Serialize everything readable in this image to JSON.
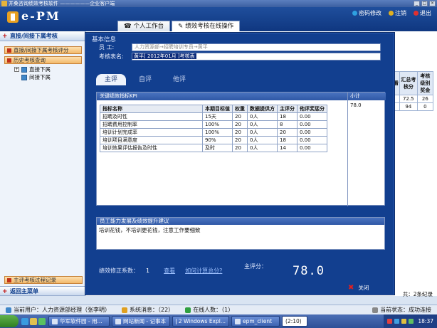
{
  "window": {
    "title": "并桑咨询绩效考核软件 ——————企业客户端"
  },
  "header": {
    "logo": "e-PM",
    "links": [
      {
        "label": "密码修改",
        "color": "#2fa0e0"
      },
      {
        "label": "注销",
        "color": "#e0b020"
      },
      {
        "label": "退出",
        "color": "#e03030"
      }
    ],
    "tabs": [
      {
        "label": "个人工作台"
      },
      {
        "label": "绩效考核在线操作"
      }
    ]
  },
  "leftnav": {
    "section": "直接/间接下属考核",
    "buttons": [
      "直接/间接下属考核评分",
      "历史考核查询"
    ],
    "tree": [
      "直接下属",
      "间接下属"
    ],
    "bottom_buttons": [
      "主评考核过程记录"
    ],
    "back_label": "返回主菜单"
  },
  "bgtable": {
    "headers": [
      "汇总考核分",
      "考核级别奖金"
    ],
    "partial_header": "看",
    "rows": [
      [
        "72.5",
        "26"
      ],
      [
        "94",
        "0"
      ]
    ]
  },
  "pager": {
    "text": "共：2条纪录"
  },
  "modal": {
    "section_basic": "基本信息",
    "employee_label": "员    工:",
    "employee_value": "人力资源部→招聘培训专员→黄平",
    "name_label": "考核表名:",
    "name_value": "黄平[ 2012年01月 ]考核表",
    "subtabs": [
      "主评",
      "自评",
      "他评"
    ],
    "kpi": {
      "title": "关键绩效指标KPI",
      "subtotal_label": "小计",
      "subtotal_value": "78.0",
      "headers": [
        "指标名称",
        "本期目标值",
        "权重",
        "数据提供方",
        "主评分",
        "他评奖惩分"
      ],
      "rows": [
        [
          "招聘及时性",
          "15天",
          "20",
          "0人",
          "18",
          "0.00"
        ],
        [
          "招聘费用控制率",
          "100%",
          "20",
          "0人",
          "8",
          "0.00"
        ],
        [
          "培训计划完成率",
          "100%",
          "20",
          "0人",
          "20",
          "0.00"
        ],
        [
          "培训项目满意度",
          "90%",
          "20",
          "0人",
          "18",
          "0.00"
        ],
        [
          "培训效果评估报告及时性",
          "及时",
          "20",
          "0人",
          "14",
          "0.00"
        ]
      ]
    },
    "dev": {
      "title": "员工能力发展及绩效提升建议",
      "text": "培训花钱，不培训更花钱，注意工作要细致"
    },
    "coeff_label": "绩效修正系数：",
    "coeff_value": "1",
    "view_link": "查看",
    "how_link": "如何计算总分?",
    "score_label": "主评分：",
    "score_value": "78.0",
    "close_label": "关闭"
  },
  "status": {
    "user": "当前用户：人力资源部经理（张李明）",
    "msgs": "系统消息：（22）",
    "online": "在线人数：（1）",
    "state": "当前状态：成功连接"
  },
  "taskbar": {
    "items": [
      "华军软件园 - 用...",
      "网站新闻 - 记事本",
      "2 Windows Expl...",
      "epm_client",
      "(2:10)"
    ],
    "clock": "18:37"
  }
}
